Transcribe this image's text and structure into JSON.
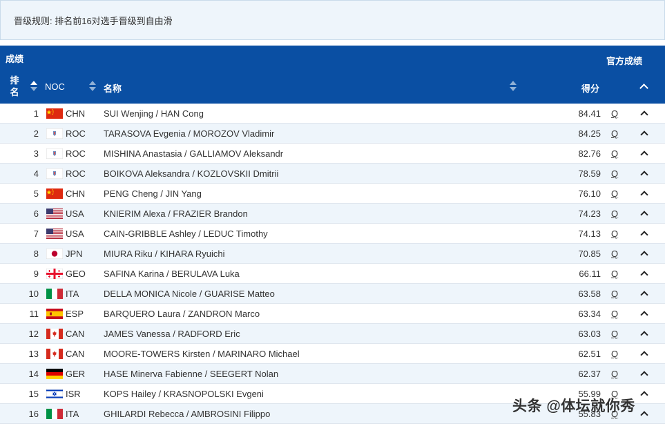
{
  "rules": {
    "text": "晋级规则: 排名前16对选手晋级到自由滑"
  },
  "header": {
    "title": "成绩",
    "official_link": "官方成绩",
    "col_rank": "排名",
    "col_noc": "NOC",
    "col_name": "名称",
    "col_score": "得分"
  },
  "rows": [
    {
      "rank": "1",
      "flag": "CHN",
      "noc": "CHN",
      "name": "SUI Wenjing / HAN Cong",
      "score": "84.41",
      "q": "Q"
    },
    {
      "rank": "2",
      "flag": "ROC",
      "noc": "ROC",
      "name": "TARASOVA Evgenia / MOROZOV Vladimir",
      "score": "84.25",
      "q": "Q"
    },
    {
      "rank": "3",
      "flag": "ROC",
      "noc": "ROC",
      "name": "MISHINA Anastasia / GALLIAMOV Aleksandr",
      "score": "82.76",
      "q": "Q"
    },
    {
      "rank": "4",
      "flag": "ROC",
      "noc": "ROC",
      "name": "BOIKOVA Aleksandra / KOZLOVSKII Dmitrii",
      "score": "78.59",
      "q": "Q"
    },
    {
      "rank": "5",
      "flag": "CHN",
      "noc": "CHN",
      "name": "PENG Cheng / JIN Yang",
      "score": "76.10",
      "q": "Q"
    },
    {
      "rank": "6",
      "flag": "USA",
      "noc": "USA",
      "name": "KNIERIM Alexa / FRAZIER Brandon",
      "score": "74.23",
      "q": "Q"
    },
    {
      "rank": "7",
      "flag": "USA",
      "noc": "USA",
      "name": "CAIN-GRIBBLE Ashley / LEDUC Timothy",
      "score": "74.13",
      "q": "Q"
    },
    {
      "rank": "8",
      "flag": "JPN",
      "noc": "JPN",
      "name": "MIURA Riku / KIHARA Ryuichi",
      "score": "70.85",
      "q": "Q"
    },
    {
      "rank": "9",
      "flag": "GEO",
      "noc": "GEO",
      "name": "SAFINA Karina / BERULAVA Luka",
      "score": "66.11",
      "q": "Q"
    },
    {
      "rank": "10",
      "flag": "ITA",
      "noc": "ITA",
      "name": "DELLA MONICA Nicole / GUARISE Matteo",
      "score": "63.58",
      "q": "Q"
    },
    {
      "rank": "11",
      "flag": "ESP",
      "noc": "ESP",
      "name": "BARQUERO Laura / ZANDRON Marco",
      "score": "63.34",
      "q": "Q"
    },
    {
      "rank": "12",
      "flag": "CAN",
      "noc": "CAN",
      "name": "JAMES Vanessa / RADFORD Eric",
      "score": "63.03",
      "q": "Q"
    },
    {
      "rank": "13",
      "flag": "CAN",
      "noc": "CAN",
      "name": "MOORE-TOWERS Kirsten / MARINARO Michael",
      "score": "62.51",
      "q": "Q"
    },
    {
      "rank": "14",
      "flag": "GER",
      "noc": "GER",
      "name": "HASE Minerva Fabienne / SEEGERT Nolan",
      "score": "62.37",
      "q": "Q"
    },
    {
      "rank": "15",
      "flag": "ISR",
      "noc": "ISR",
      "name": "KOPS Hailey / KRASNOPOLSKI Evgeni",
      "score": "55.99",
      "q": "Q"
    },
    {
      "rank": "16",
      "flag": "ITA",
      "noc": "ITA",
      "name": "GHILARDI Rebecca / AMBROSINI Filippo",
      "score": "55.83",
      "q": "Q"
    }
  ],
  "watermark": "头条 @体坛就你秀",
  "colors": {
    "header_bg": "#0a4fa3",
    "row_alt_bg": "#eef5fb",
    "rules_bg": "#eef5fb"
  }
}
